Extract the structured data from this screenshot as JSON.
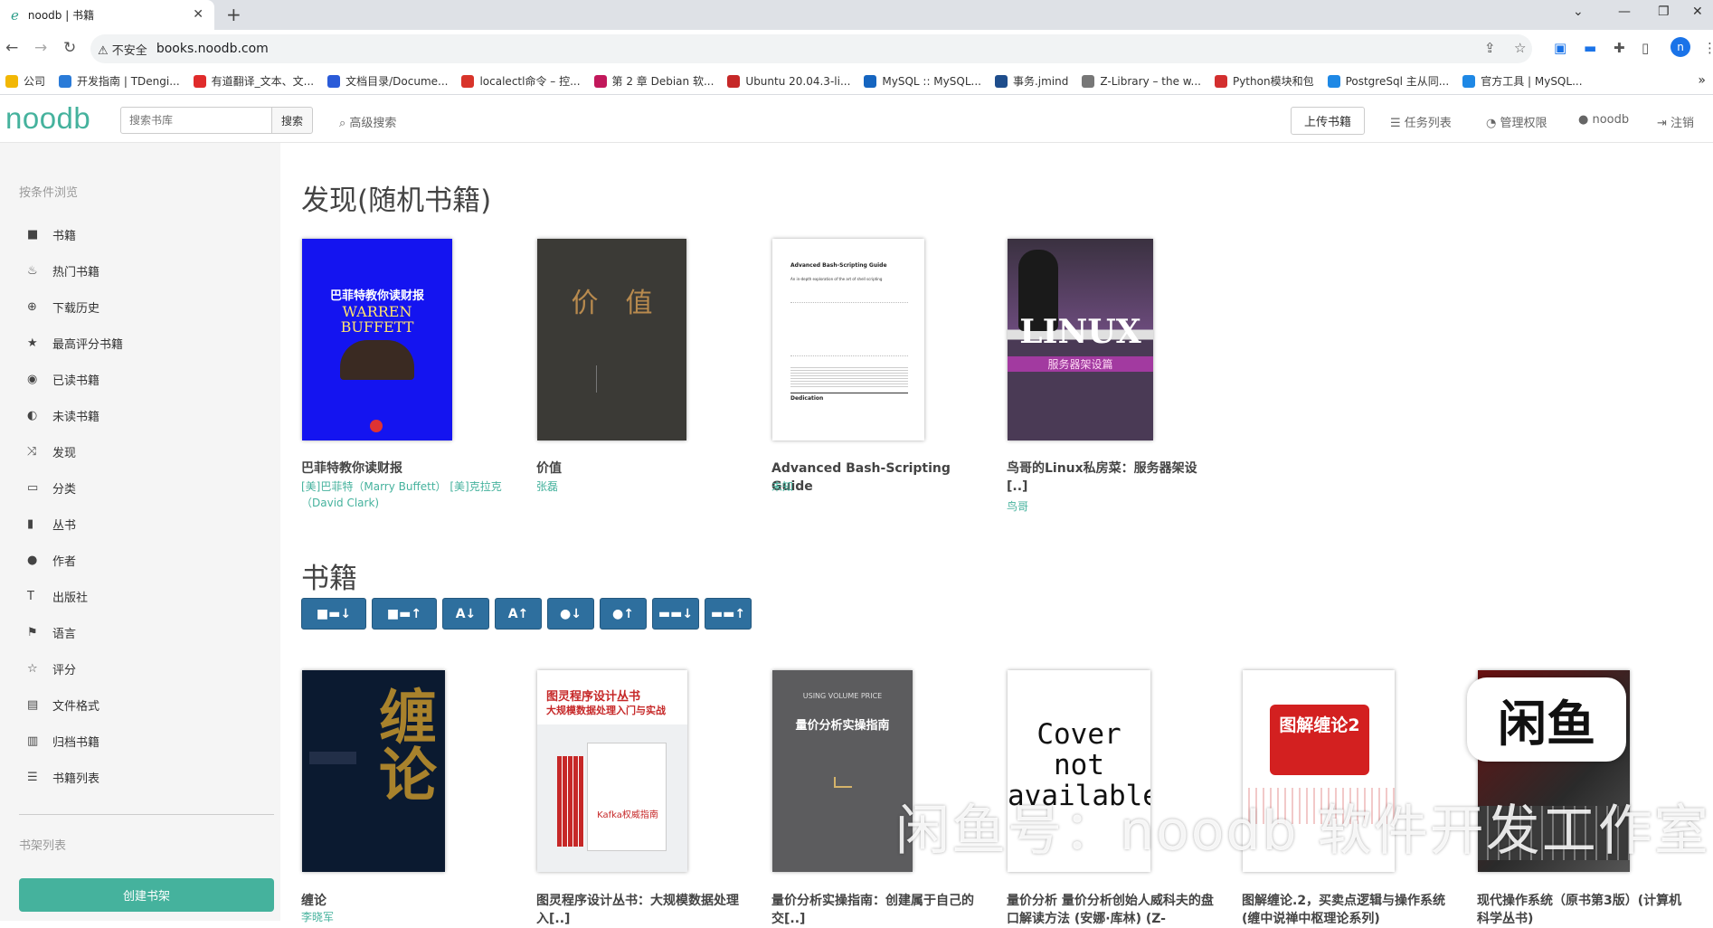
{
  "browser": {
    "tab_title": "noodb | 书籍",
    "tab_icon": "e",
    "new_tab": "+",
    "security_label": "不安全",
    "url": "books.noodb.com",
    "profile_initial": "n",
    "bookmarks": [
      {
        "label": "公司",
        "color": "#f2b705"
      },
      {
        "label": "开发指南 | TDengi...",
        "color": "#2a7bd8"
      },
      {
        "label": "有道翻译_文本、文...",
        "color": "#e02b2b"
      },
      {
        "label": "文档目录/Docume...",
        "color": "#2a5bd8"
      },
      {
        "label": "localectl命令 – 控...",
        "color": "#d8342a"
      },
      {
        "label": "第 2 章 Debian 软...",
        "color": "#c2185b"
      },
      {
        "label": "Ubuntu 20.04.3-li...",
        "color": "#c62828"
      },
      {
        "label": "MySQL :: MySQL...",
        "color": "#1565c0"
      },
      {
        "label": "事务.jmind",
        "color": "#1e4d8c"
      },
      {
        "label": "Z-Library – the w...",
        "color": "#777777"
      },
      {
        "label": "Python模块和包",
        "color": "#d32f2f"
      },
      {
        "label": "PostgreSql 主从同...",
        "color": "#1e88e5"
      },
      {
        "label": "官方工具 | MySQL...",
        "color": "#1e88e5"
      }
    ]
  },
  "navbar": {
    "brand": "noodb",
    "search_placeholder": "搜索书库",
    "search_button": "搜索",
    "advanced_search": "高级搜索",
    "upload": "上传书籍",
    "tasks": "任务列表",
    "admin": "管理权限",
    "user": "noodb",
    "logout": "注销"
  },
  "sidebar": {
    "browse_heading": "按条件浏览",
    "items": [
      {
        "icon": "book-icon",
        "glyph": "■",
        "label": "书籍"
      },
      {
        "icon": "fire-icon",
        "glyph": "♨",
        "label": "热门书籍"
      },
      {
        "icon": "download-icon",
        "glyph": "⊕",
        "label": "下载历史"
      },
      {
        "icon": "star-icon",
        "glyph": "★",
        "label": "最高评分书籍"
      },
      {
        "icon": "eye-icon",
        "glyph": "◉",
        "label": "已读书籍"
      },
      {
        "icon": "eye-slash-icon",
        "glyph": "◐",
        "label": "未读书籍"
      },
      {
        "icon": "shuffle-icon",
        "glyph": "⤨",
        "label": "发现"
      },
      {
        "icon": "inbox-icon",
        "glyph": "▭",
        "label": "分类"
      },
      {
        "icon": "bookmark-icon",
        "glyph": "▮",
        "label": "丛书"
      },
      {
        "icon": "user-icon",
        "glyph": "●",
        "label": "作者"
      },
      {
        "icon": "text-icon",
        "glyph": "T",
        "label": "出版社"
      },
      {
        "icon": "flag-icon",
        "glyph": "⚑",
        "label": "语言"
      },
      {
        "icon": "star-empty-icon",
        "glyph": "☆",
        "label": "评分"
      },
      {
        "icon": "file-icon",
        "glyph": "▤",
        "label": "文件格式"
      },
      {
        "icon": "trash-icon",
        "glyph": "▥",
        "label": "归档书籍"
      },
      {
        "icon": "list-icon",
        "glyph": "☰",
        "label": "书籍列表"
      }
    ],
    "shelves_heading": "书架列表",
    "create_shelf": "创建书架"
  },
  "discover": {
    "title": "发现(随机书籍)",
    "books": [
      {
        "title": "巴菲特教你读财报",
        "author": "[美]巴菲特（Marry Buffett） [美]克拉克（David Clark)"
      },
      {
        "title": "价值",
        "author": "张磊"
      },
      {
        "title": "Advanced Bash-Scripting Guide",
        "author": "未知"
      },
      {
        "title": "鸟哥的Linux私房菜：服务器架设[..]",
        "author": "鸟哥"
      }
    ]
  },
  "books_section": {
    "title": "书籍",
    "sort_buttons": [
      "■▬↓",
      "■▬↑",
      "A↓",
      "A↑",
      "●↓",
      "●↑",
      "▬▬↓",
      "▬▬↑"
    ],
    "books": [
      {
        "title": "缠论",
        "author": "李晓军"
      },
      {
        "title": "图灵程序设计丛书：大规模数据处理入[..]",
        "author": ""
      },
      {
        "title": "量价分析实操指南：创建属于自己的交[..]",
        "author": ""
      },
      {
        "title": "量价分析 量价分析创始人威科夫的盘口解读方法 (安娜·库林) (Z-",
        "author": ""
      },
      {
        "title": "图解缠论.2，买卖点逻辑与操作系统 (缠中说禅中枢理论系列)",
        "author": ""
      },
      {
        "title": "现代操作系统（原书第3版）(计算机科学丛书)",
        "author": ""
      }
    ]
  },
  "covers": {
    "buffett_top": "巴菲特教你读财报",
    "buffett_en": "WARREN BUFFETT",
    "value_text": "价　值",
    "bash_title": "Advanced Bash-Scripting Guide",
    "bash_sub": "An in-depth exploration of the art of shell scripting",
    "bash_dedication": "Dedication",
    "linux_big": "LINUX",
    "linux_sub": "服务器架设篇",
    "chanlun_big": "缠论",
    "turing_title": "图灵程序设计丛书",
    "turing_sub": "大规模数据处理入门与实战",
    "kafka": "Kafka权威指南",
    "volume_en": "USING VOLUME PRICE",
    "volume_cn": "量价分析实操指南",
    "no_cover": "Cover not available",
    "tujie": "图解缠论2"
  },
  "watermark": "闲鱼号：noodb 软件开发工作室",
  "watermark_logo": "闲鱼"
}
